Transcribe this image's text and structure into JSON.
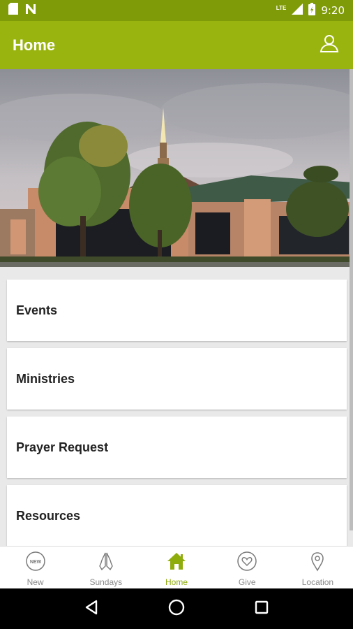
{
  "status_bar": {
    "time": "9:20",
    "network": "LTE",
    "left_icons": [
      "sd-card-icon",
      "n-notification-icon"
    ],
    "right_icons": [
      "signal-icon",
      "battery-icon"
    ]
  },
  "app_bar": {
    "title": "Home",
    "profile_icon": "user-icon"
  },
  "hero": {
    "image": "church-building-photo"
  },
  "menu": {
    "items": [
      {
        "label": "Events"
      },
      {
        "label": "Ministries"
      },
      {
        "label": "Prayer Request"
      },
      {
        "label": "Resources"
      }
    ]
  },
  "bottom_nav": {
    "items": [
      {
        "label": "New",
        "icon": "new-badge-icon",
        "active": false
      },
      {
        "label": "Sundays",
        "icon": "praying-hands-icon",
        "active": false
      },
      {
        "label": "Home",
        "icon": "home-icon",
        "active": true
      },
      {
        "label": "Give",
        "icon": "heart-icon",
        "active": false
      },
      {
        "label": "Location",
        "icon": "location-pin-icon",
        "active": false
      }
    ],
    "new_badge_text": "NEW"
  },
  "colors": {
    "status_bar": "#7f9b07",
    "app_bar": "#9ab40f",
    "accent": "#8fac0d",
    "inactive": "#8a8a8a"
  }
}
